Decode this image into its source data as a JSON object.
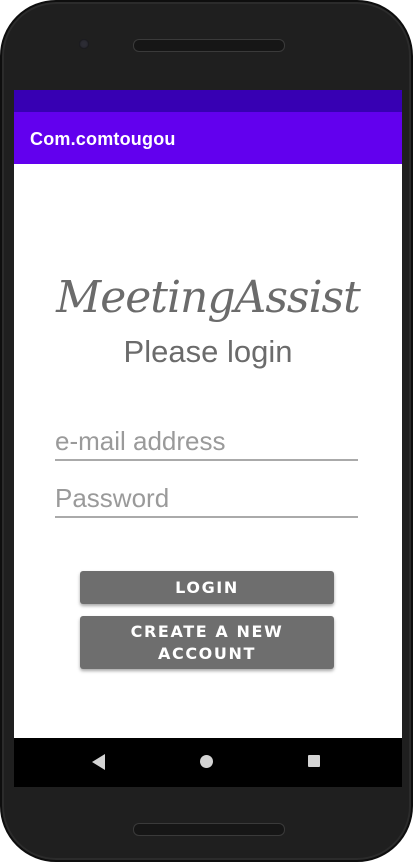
{
  "app_bar": {
    "title": "Com.comtougou",
    "color": "#6200ee",
    "status_bar_color": "#3700b3"
  },
  "login_screen": {
    "logo_text": "MeetingAssist",
    "subtitle": "Please login",
    "email_field": {
      "placeholder": "e-mail address",
      "value": ""
    },
    "password_field": {
      "placeholder": "Password",
      "value": ""
    },
    "login_button": "LOGIN",
    "create_account_button": {
      "line1": "CREATE A NEW",
      "line2": "ACCOUNT"
    }
  },
  "nav_bar": {
    "back_icon": "back-triangle-icon",
    "home_icon": "home-circle-icon",
    "recents_icon": "recents-square-icon"
  }
}
